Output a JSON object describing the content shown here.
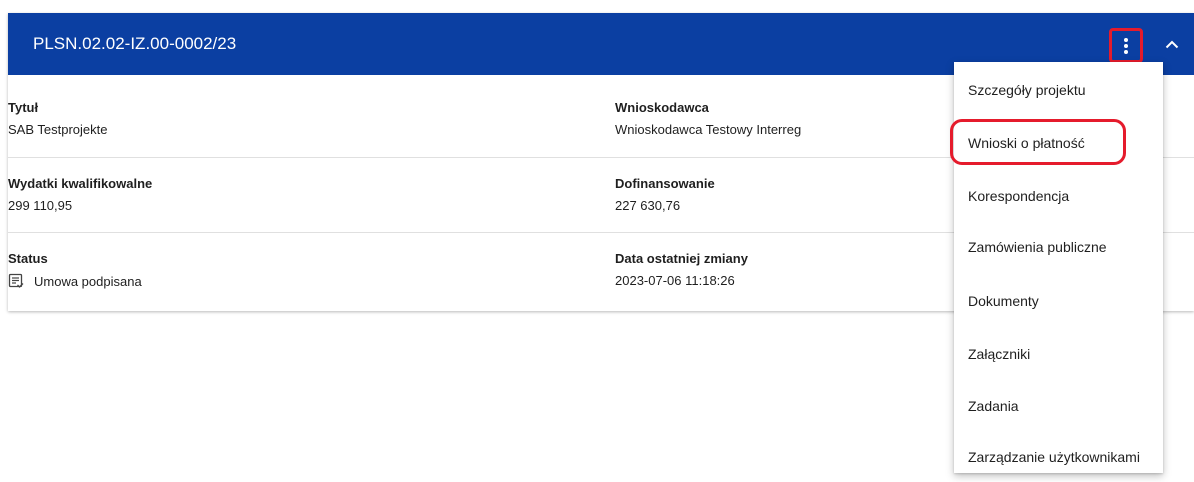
{
  "project": {
    "number": "PLSN.02.02-IZ.00-0002/23",
    "header_color": "#0b3fa2",
    "more_icon": "more-vert-icon",
    "collapse_icon": "chevron-up-icon"
  },
  "details": {
    "title_label": "Tytuł",
    "title_value": "SAB Testprojekte",
    "applicant_label": "Wnioskodawca",
    "applicant_value": "Wnioskodawca Testowy Interreg",
    "eligible_label": "Wydatki kwalifikowalne",
    "eligible_value": "299 110,95",
    "cofinancing_label": "Dofinansowanie",
    "cofinancing_value": "227 630,76",
    "status_label": "Status",
    "status_icon": "document-check-icon",
    "status_value": "Umowa podpisana",
    "last_change_label": "Data ostatniej zmiany",
    "last_change_value": "2023-07-06 11:18:26"
  },
  "menu": {
    "items": [
      {
        "label": "Szczegóły projektu"
      },
      {
        "label": "Wnioski o płatność"
      },
      {
        "label": "Korespondencja"
      },
      {
        "label": "Zamówienia publiczne"
      },
      {
        "label": "Dokumenty"
      },
      {
        "label": "Załączniki"
      },
      {
        "label": "Zadania"
      },
      {
        "label": "Zarządzanie użytkownikami"
      }
    ],
    "highlight_color": "#e51b2c"
  }
}
